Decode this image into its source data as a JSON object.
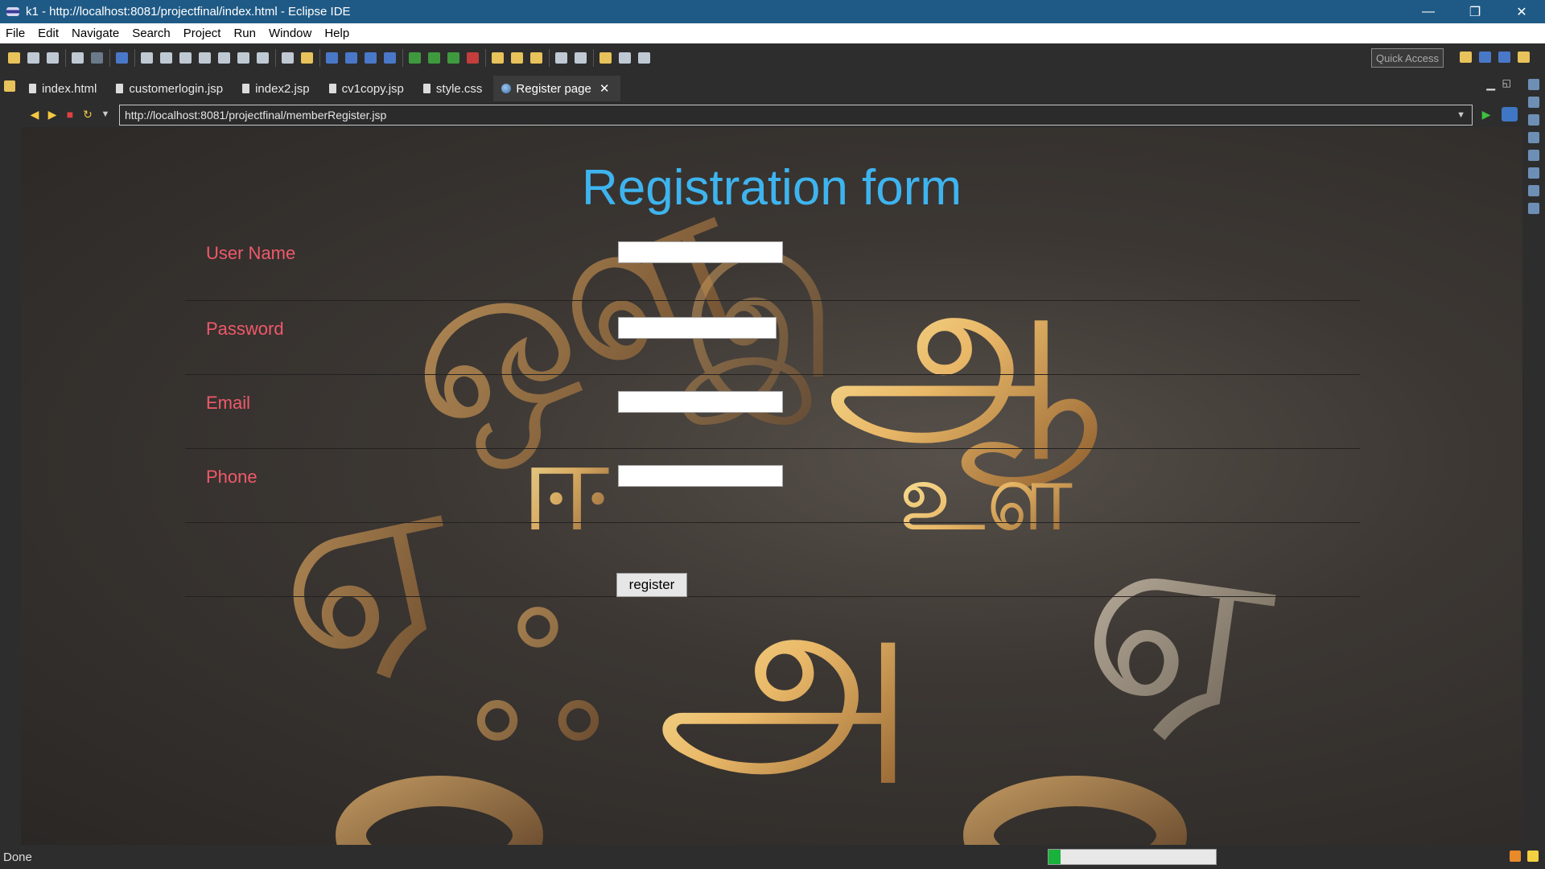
{
  "window": {
    "title": "k1 - http://localhost:8081/projectfinal/index.html - Eclipse IDE",
    "controls": {
      "minimize": "—",
      "restore": "❐",
      "close": "✕"
    }
  },
  "menu": {
    "items": [
      "File",
      "Edit",
      "Navigate",
      "Search",
      "Project",
      "Run",
      "Window",
      "Help"
    ]
  },
  "toolbar": {
    "quick_access": "Quick Access"
  },
  "tabs": [
    {
      "label": "index.html",
      "active": false
    },
    {
      "label": "customerlogin.jsp",
      "active": false
    },
    {
      "label": "index2.jsp",
      "active": false
    },
    {
      "label": "cv1copy.jsp",
      "active": false
    },
    {
      "label": "style.css",
      "active": false
    },
    {
      "label": "Register page",
      "active": true
    }
  ],
  "browser": {
    "url": "http://localhost:8081/projectfinal/memberRegister.jsp"
  },
  "page": {
    "title": "Registration form",
    "fields": [
      {
        "label": "User Name",
        "value": ""
      },
      {
        "label": "Password",
        "value": ""
      },
      {
        "label": "Email",
        "value": ""
      },
      {
        "label": "Phone",
        "value": ""
      }
    ],
    "submit_label": "register",
    "background_glyphs": [
      "ஔ",
      "இ",
      "ஆ",
      "ஈ",
      "ஏ",
      "ஃ",
      "உள",
      "அ",
      "ஏ"
    ]
  },
  "status": {
    "text": "Done",
    "progress": 0.07
  },
  "colors": {
    "title_bar": "#1f5a86",
    "page_title": "#3eb4ef",
    "form_label": "#f0596b",
    "progress_fill": "#19b23b"
  }
}
